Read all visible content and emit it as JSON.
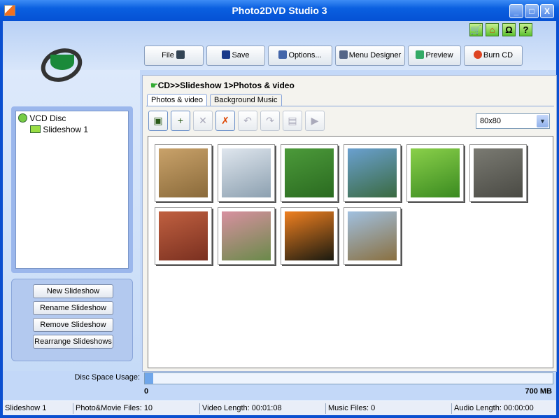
{
  "window": {
    "title": "Photo2DVD Studio 3",
    "minimize": "_",
    "maximize": "□",
    "close": "X"
  },
  "top_icons": [
    {
      "name": "cart-icon",
      "glyph": "🛒"
    },
    {
      "name": "home-icon",
      "glyph": "⌂"
    },
    {
      "name": "support-icon",
      "glyph": "Ω"
    },
    {
      "name": "help-icon",
      "glyph": "?"
    }
  ],
  "toolbar": {
    "file": "File",
    "save": "Save",
    "options": "Options...",
    "menu_designer": "Menu Designer",
    "preview": "Preview",
    "burn": "Burn CD"
  },
  "tree": {
    "root": "VCD Disc",
    "child": "Slideshow 1"
  },
  "left_buttons": {
    "new": "New Slideshow",
    "rename": "Rename Slideshow",
    "remove": "Remove Slideshow",
    "rearrange": "Rearrange Slideshows"
  },
  "breadcrumb": "CD>>Slideshow 1>Photos & video",
  "tabs": {
    "photos": "Photos & video",
    "music": "Background Music"
  },
  "thumb_size": "80x80",
  "thumbnails": [
    {
      "name": "cracked-earth-sprout",
      "colors": [
        "#c9a26a",
        "#8a6a3a"
      ]
    },
    {
      "name": "white-flowers",
      "colors": [
        "#dfe6ee",
        "#8ca0b0"
      ]
    },
    {
      "name": "green-leaves",
      "colors": [
        "#4c9a3a",
        "#2a6a20"
      ]
    },
    {
      "name": "cattail",
      "colors": [
        "#6aa0d0",
        "#3a6a40"
      ]
    },
    {
      "name": "mushroom-grass",
      "colors": [
        "#8ad04a",
        "#3a8a20"
      ]
    },
    {
      "name": "leaf-on-gravel",
      "colors": [
        "#7a7a72",
        "#4a4a44"
      ]
    },
    {
      "name": "autumn-trees",
      "colors": [
        "#c06040",
        "#7a3020"
      ]
    },
    {
      "name": "pink-flower",
      "colors": [
        "#d890a0",
        "#6a8a4a"
      ]
    },
    {
      "name": "orange-leaf",
      "colors": [
        "#f08020",
        "#1a1a10"
      ]
    },
    {
      "name": "hut",
      "colors": [
        "#a0c0e0",
        "#8a7040"
      ]
    }
  ],
  "usage": {
    "label": "Disc Space Usage:",
    "min": "0",
    "max": "700 MB",
    "fraction": 0.02
  },
  "status": {
    "slideshow": "Slideshow 1",
    "files": "Photo&Movie Files: 10",
    "video": "Video Length: 00:01:08",
    "music": "Music Files: 0",
    "audio": "Audio Length: 00:00:00"
  }
}
